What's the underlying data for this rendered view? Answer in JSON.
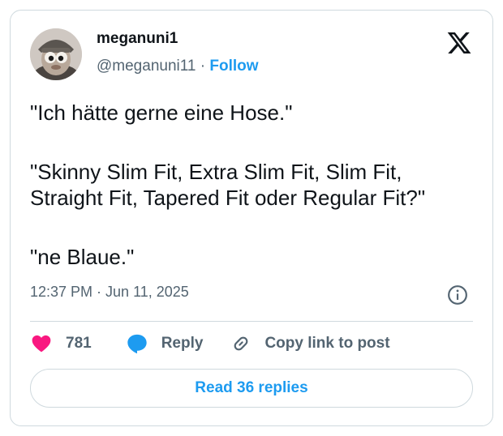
{
  "tweet": {
    "author_name": "meganuni1",
    "author_handle": "@meganuni11",
    "separator": "·",
    "follow_label": "Follow",
    "text_lines": [
      "\"Ich hätte gerne eine Hose.\"",
      "\"Skinny Slim Fit, Extra Slim Fit, Slim Fit,",
      "Straight Fit, Tapered Fit oder Regular Fit?\"",
      "\"ne Blaue.\""
    ],
    "timestamp": "12:37 PM · Jun 11, 2025",
    "likes": "781",
    "reply_label": "Reply",
    "copy_link_label": "Copy link to post",
    "read_replies_label": "Read 36 replies"
  },
  "colors": {
    "accent": "#1d9bf0",
    "like": "#f91880",
    "text": "#0f1419",
    "secondary": "#536471",
    "border": "#cfd9de"
  },
  "icons": {
    "logo": "x-logo-icon",
    "info": "info-icon",
    "like": "heart-icon",
    "reply": "speech-bubble-icon",
    "copy": "link-icon"
  }
}
